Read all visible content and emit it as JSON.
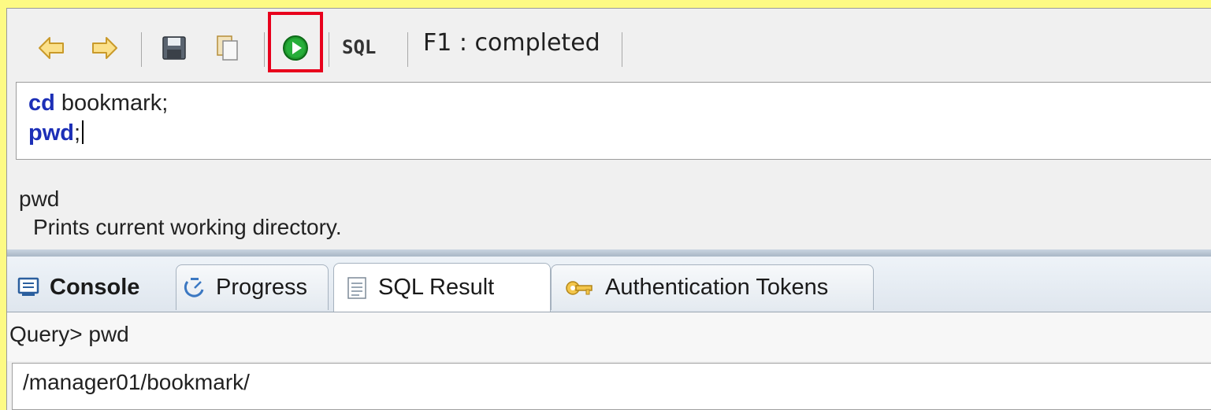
{
  "toolbar": {
    "undo_icon": "undo-arrow-icon",
    "redo_icon": "redo-arrow-icon",
    "save_icon": "save-disk-icon",
    "copy_icon": "copy-document-icon",
    "run_icon": "run-play-icon",
    "sql_label": "SQL",
    "status": "F1 : completed"
  },
  "editor": {
    "line1": {
      "keyword": "cd",
      "rest": " bookmark;"
    },
    "line2": {
      "keyword": "pwd",
      "rest": ";"
    }
  },
  "help": {
    "command": "pwd",
    "description": "Prints current working directory."
  },
  "tabs": [
    {
      "label": "Console",
      "icon": "console-icon"
    },
    {
      "label": "Progress",
      "icon": "progress-icon"
    },
    {
      "label": "SQL Result",
      "icon": "sql-result-icon"
    },
    {
      "label": "Authentication Tokens",
      "icon": "tokens-icon"
    }
  ],
  "result": {
    "query": "Query> pwd",
    "output": "/manager01/bookmark/"
  },
  "colors": {
    "background": "#fdfa84",
    "highlight": "#e8001c",
    "keyword": "#1c2fb7",
    "run_green": "#1f9a2e"
  }
}
